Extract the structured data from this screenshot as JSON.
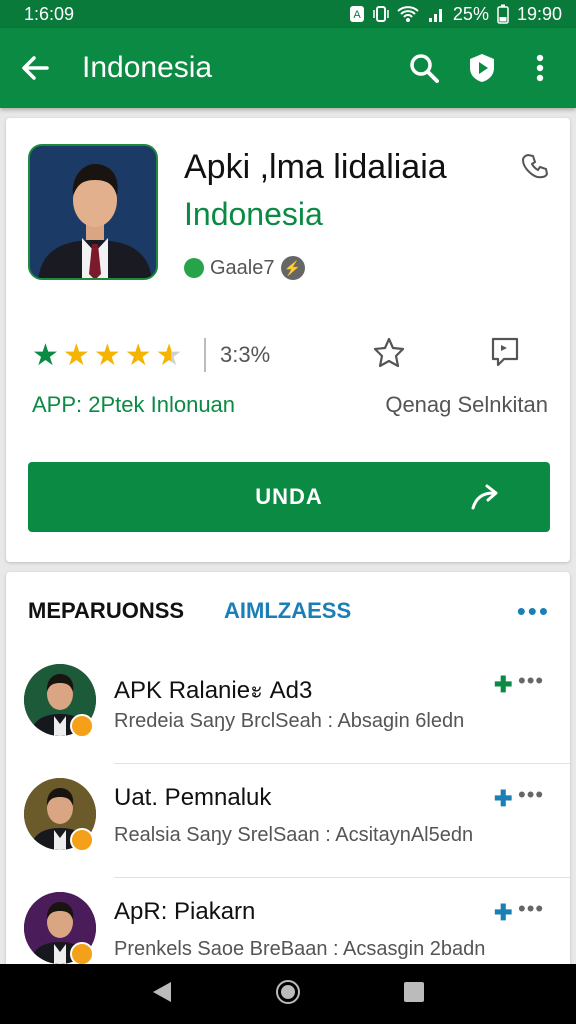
{
  "status_bar": {
    "time": "1:6:09",
    "battery": "25%",
    "clock": "19:90"
  },
  "app_bar": {
    "title": "Indonesia"
  },
  "app": {
    "name": "Apki ,lma lidaliaia",
    "developer": "Indonesia",
    "meta": "Gaale7",
    "rating_count": "3:3%",
    "rating_stars": 4.5,
    "category": "APP: 2Ptek Inlonuan",
    "report_link": "Qenag Selnkitan",
    "install_label": "UNDA"
  },
  "tabs": {
    "active": "MEPARUONSS",
    "other": "AIMLZAESS",
    "more": "•••"
  },
  "list": [
    {
      "title": "APK Ralanieะ Ad3",
      "subtitle": "Rredeia Saŋy BrclSeah :  Absagin 6ledn",
      "add_color": "#0b8a43"
    },
    {
      "title": "Uat. Pemnaluk",
      "subtitle": "Realsia Saŋy SrelSaan :  AcsitaynAl5edn",
      "add_color": "#1a7fb5"
    },
    {
      "title": "ApR: Piakarn",
      "subtitle": "Prenkels Saoe BreBaan :  Acsasgin 2badn",
      "add_color": "#1a7fb5"
    }
  ],
  "colors": {
    "primary": "#0b8a43",
    "accent": "#1a7fb5",
    "status_bar": "#0a7a3a"
  },
  "icons": [
    "back-arrow-icon",
    "search-icon",
    "play-protect-icon",
    "overflow-menu-icon",
    "phone-icon",
    "wishlist-icon",
    "flag-icon",
    "share-icon",
    "nav-back-icon",
    "nav-home-icon",
    "nav-recents-icon"
  ]
}
